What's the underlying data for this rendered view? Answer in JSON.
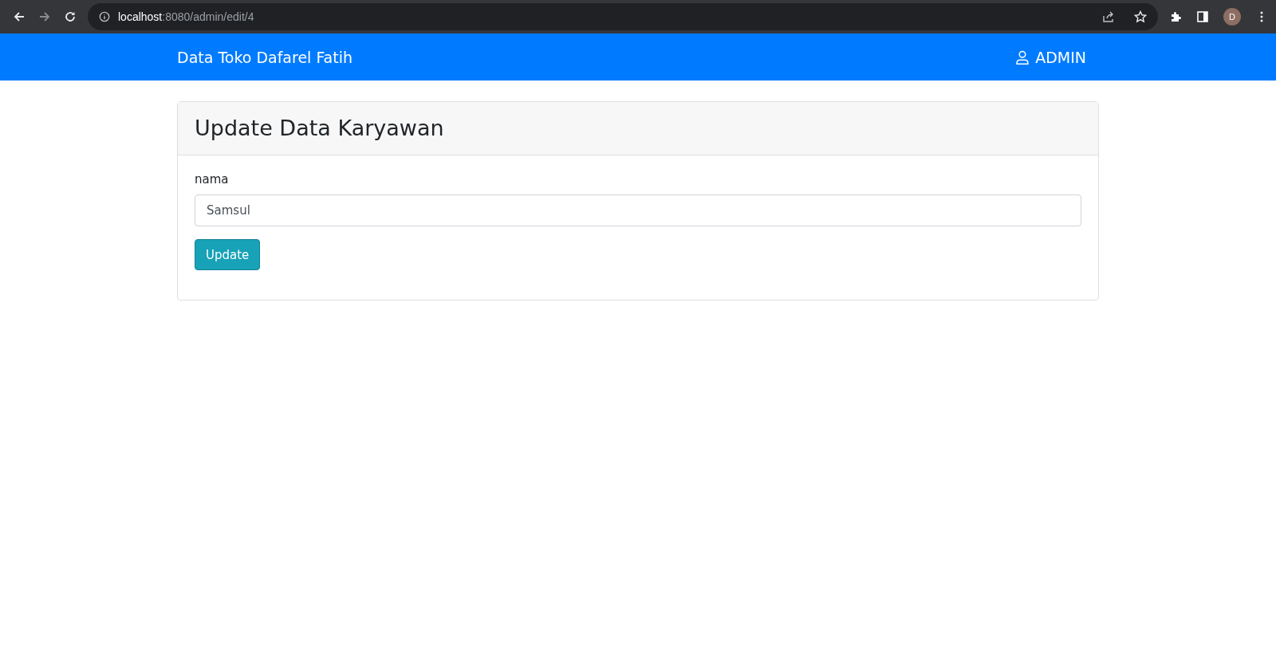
{
  "browser": {
    "url_host": "localhost",
    "url_path": ":8080/admin/edit/4",
    "profile_initial": "D"
  },
  "navbar": {
    "brand": "Data Toko Dafarel Fatih",
    "user": "ADMIN"
  },
  "card": {
    "title": "Update Data Karyawan",
    "fields": [
      {
        "label": "nama",
        "value": "Samsul"
      }
    ],
    "submit": "Update"
  }
}
